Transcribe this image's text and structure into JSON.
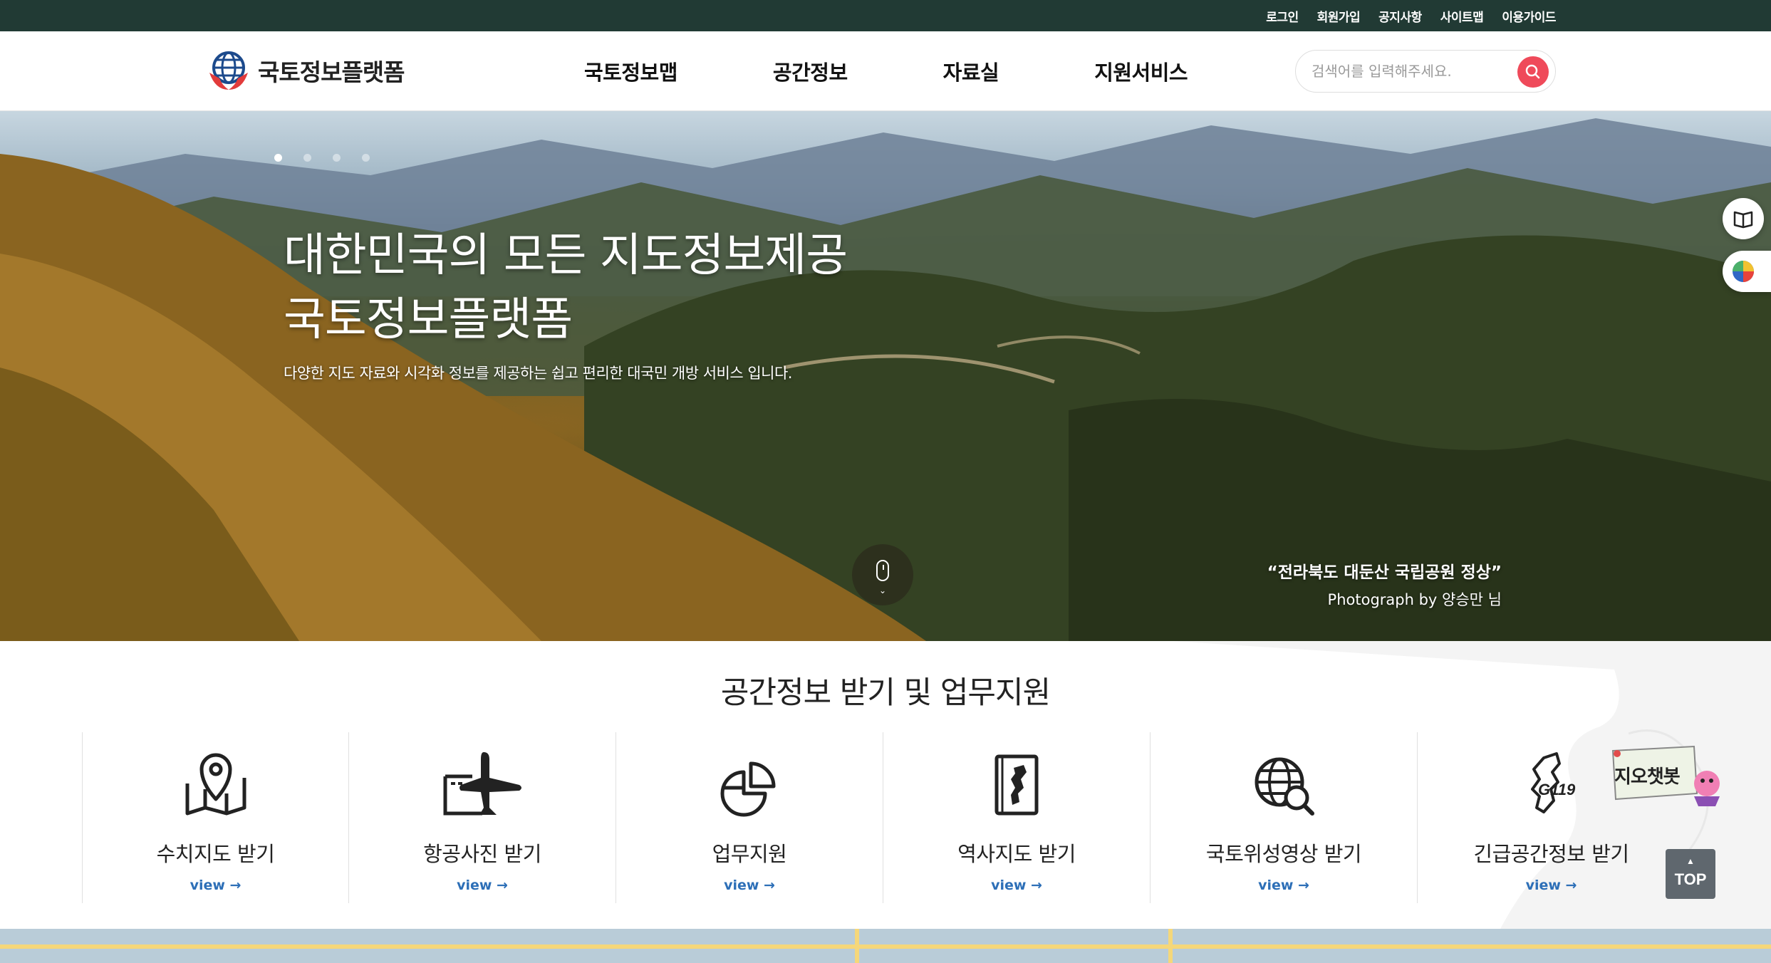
{
  "util_nav": {
    "items": [
      "로그인",
      "회원가입",
      "공지사항",
      "사이트맵",
      "이용가이드"
    ]
  },
  "header": {
    "logo_text": "국토정보플랫폼",
    "gnb": [
      "국토정보맵",
      "공간정보",
      "자료실",
      "지원서비스"
    ],
    "search_placeholder": "검색어를 입력해주세요."
  },
  "hero": {
    "title_line1": "대한민국의 모든 지도정보제공",
    "title_line2": "국토정보플랫폼",
    "subtitle": "다양한 지도 자료와 시각화 정보를 제공하는 쉽고 편리한 대국민 개방 서비스 입니다.",
    "caption_title": "“전라북도 대둔산 국립공원 정상”",
    "caption_credit": "Photograph by 양승만 님",
    "slide_count": 4,
    "active_slide": 1
  },
  "services": {
    "title": "공간정보 받기 및 업무지원",
    "items": [
      {
        "label": "수치지도 받기",
        "view": "view →",
        "icon": "folded-map-pin-icon"
      },
      {
        "label": "항공사진 받기",
        "view": "view →",
        "icon": "airplane-photo-icon"
      },
      {
        "label": "업무지원",
        "view": "view →",
        "icon": "pie-chart-icon"
      },
      {
        "label": "역사지도 받기",
        "view": "view →",
        "icon": "korea-map-book-icon"
      },
      {
        "label": "국토위성영상 받기",
        "view": "view →",
        "icon": "globe-search-icon"
      },
      {
        "label": "긴급공간정보 받기",
        "view": "view →",
        "icon": "g119-icon"
      }
    ]
  },
  "chatbot": {
    "label": "지오챗봇"
  },
  "top_button": {
    "label": "TOP"
  },
  "colors": {
    "util_bar": "#213a34",
    "search_button": "#ef4a5a",
    "view_link": "#2d6fb7",
    "top_button": "#5f676e"
  }
}
